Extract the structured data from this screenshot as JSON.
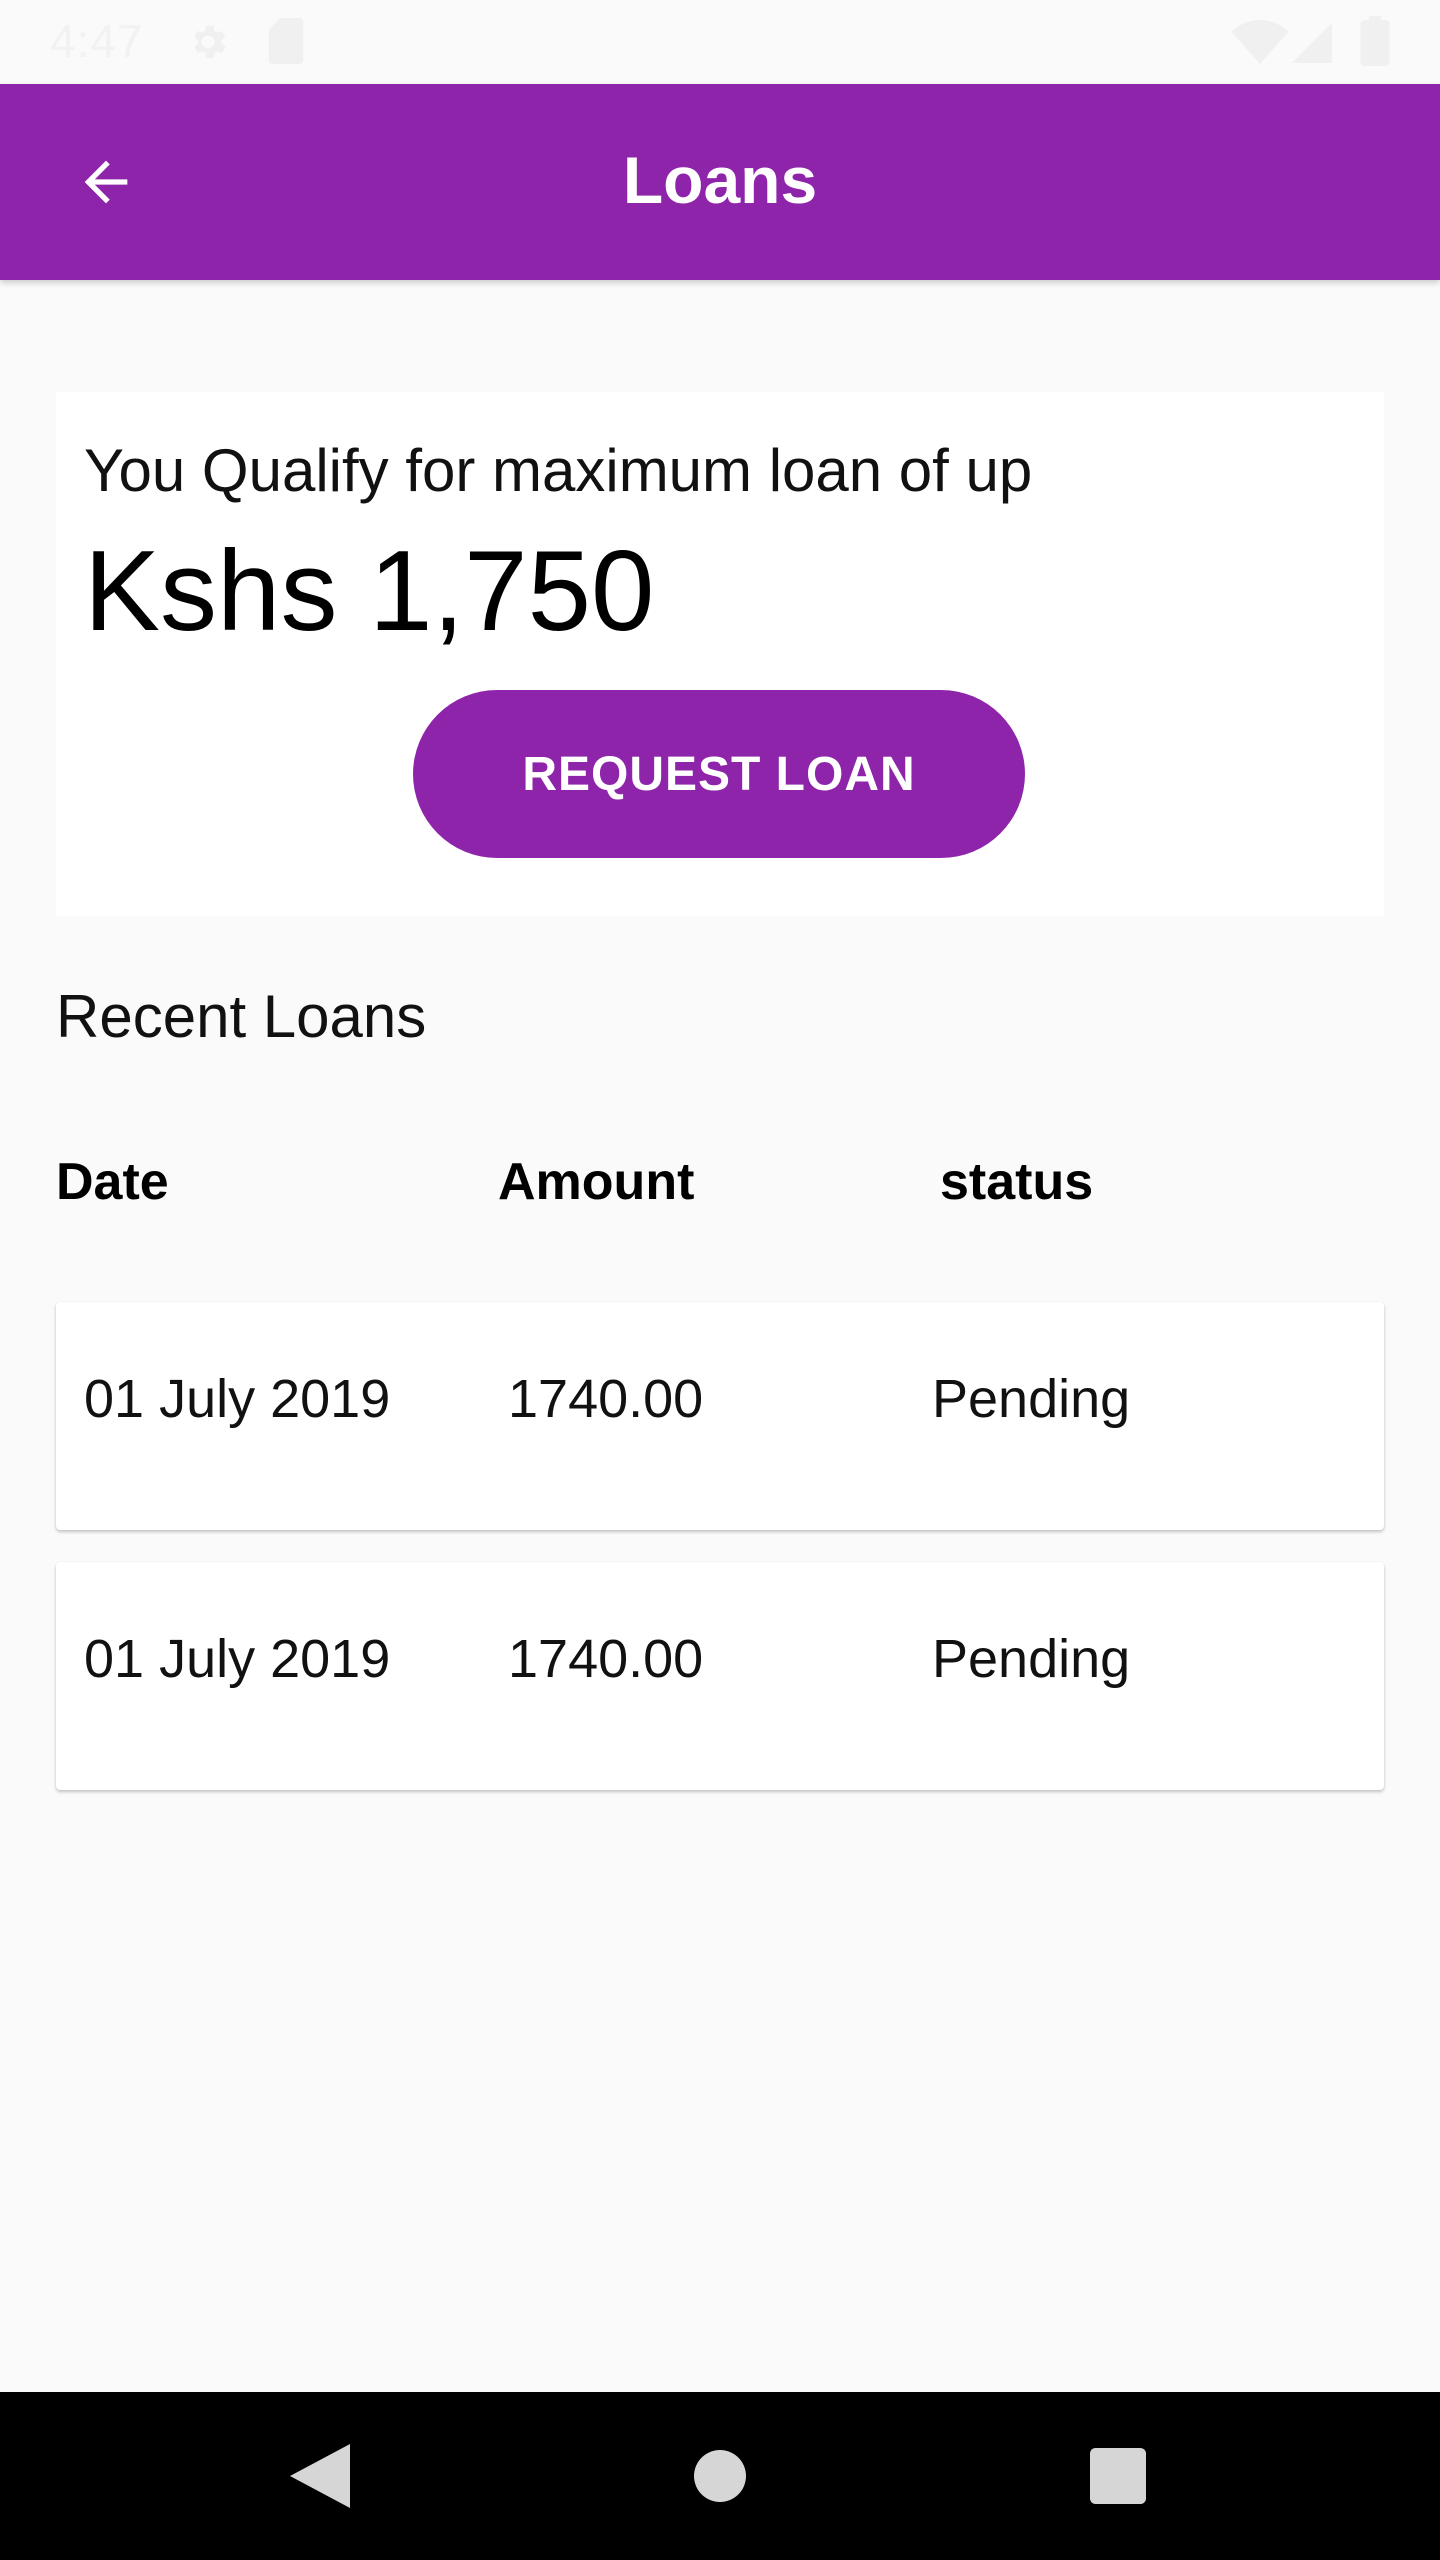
{
  "status_bar": {
    "time": "4:47",
    "icons": [
      "gear-icon",
      "sd-card-icon",
      "wifi-icon",
      "signal-icon",
      "battery-icon"
    ]
  },
  "app_bar": {
    "title": "Loans",
    "back_icon": "arrow-left-icon",
    "color": "#8e24aa"
  },
  "qualify_card": {
    "text": "You Qualify for maximum loan of up",
    "amount": "Kshs 1,750",
    "button_label": "REQUEST LOAN"
  },
  "recent_loans": {
    "title": "Recent Loans",
    "columns": [
      "Date",
      "Amount",
      "status"
    ],
    "rows": [
      {
        "date": "01 July 2019",
        "amount": "1740.00",
        "status": "Pending"
      },
      {
        "date": "01 July 2019",
        "amount": "1740.00",
        "status": "Pending"
      }
    ]
  },
  "nav_bar": {
    "icons": [
      "back-triangle-icon",
      "home-circle-icon",
      "recents-square-icon"
    ]
  }
}
